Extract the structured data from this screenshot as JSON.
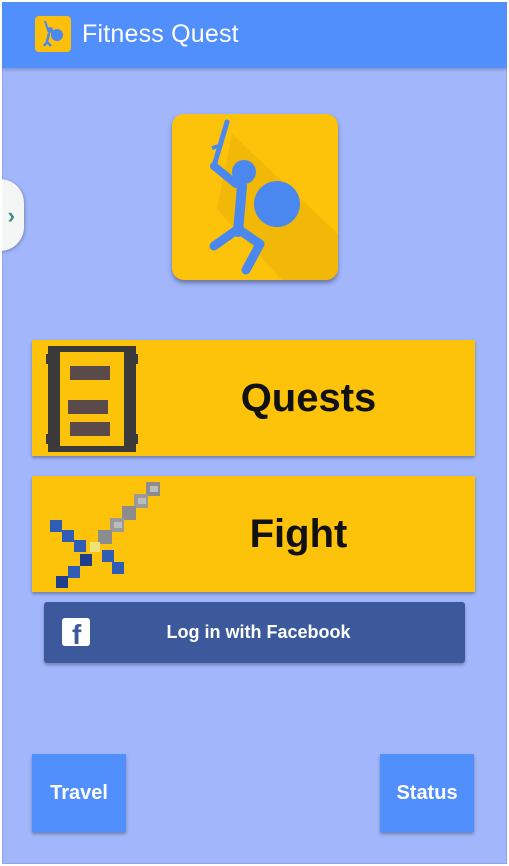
{
  "app": {
    "title": "Fitness Quest"
  },
  "buttons": {
    "quests": "Quests",
    "fight": "Fight",
    "facebook": "Log in with Facebook",
    "travel": "Travel",
    "status": "Status"
  },
  "icons": {
    "app": "stick-warrior-icon",
    "drawer": "chevron-right-icon",
    "quests": "quest-scroll-icon",
    "fight": "pixel-sword-icon",
    "facebook": "facebook-icon"
  },
  "colors": {
    "background": "#a1b6fb",
    "appbar": "#518ffd",
    "gold": "#fdc20a",
    "facebook": "#3c5a9b",
    "nav_button": "#518ffd"
  }
}
